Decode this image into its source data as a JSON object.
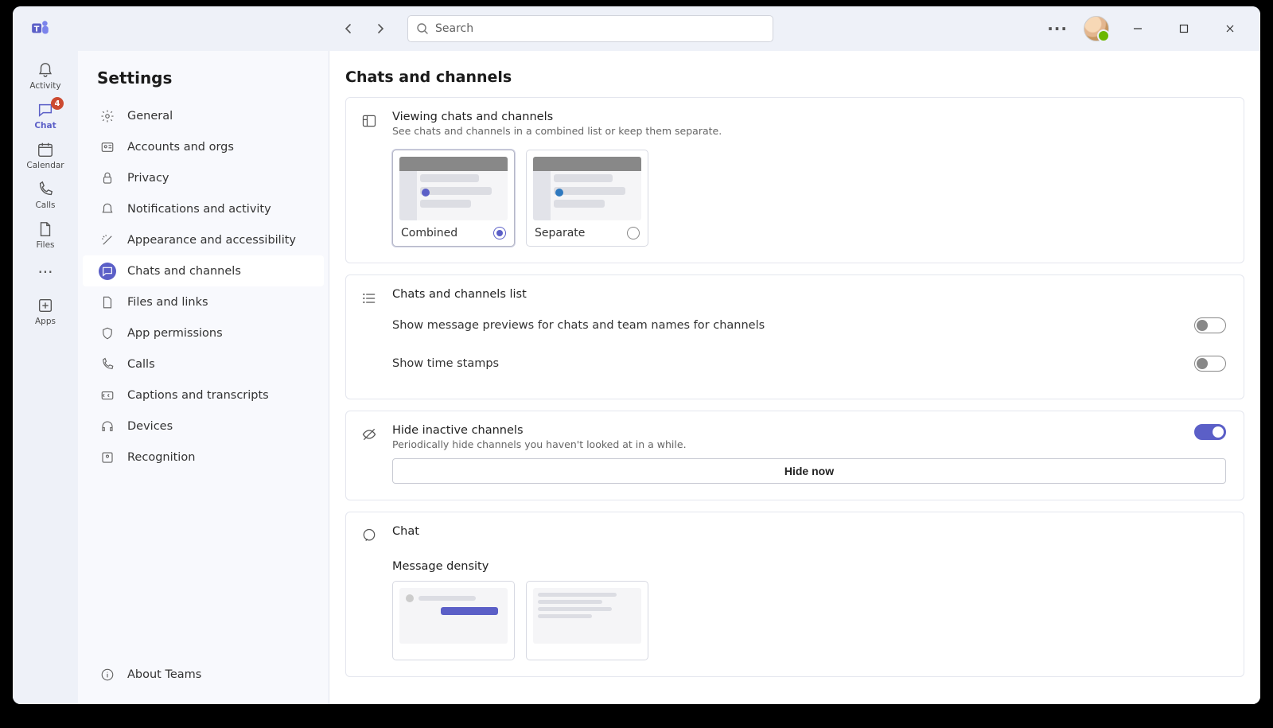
{
  "search": {
    "placeholder": "Search"
  },
  "rail": {
    "activity": {
      "label": "Activity"
    },
    "chat": {
      "label": "Chat",
      "badge": "4"
    },
    "calendar": {
      "label": "Calendar"
    },
    "calls": {
      "label": "Calls"
    },
    "files": {
      "label": "Files"
    },
    "apps": {
      "label": "Apps"
    }
  },
  "nav": {
    "title": "Settings",
    "items": {
      "general": "General",
      "accounts": "Accounts and orgs",
      "privacy": "Privacy",
      "notifications": "Notifications and activity",
      "appearance": "Appearance and accessibility",
      "chats": "Chats and channels",
      "files": "Files and links",
      "permissions": "App permissions",
      "calls": "Calls",
      "captions": "Captions and transcripts",
      "devices": "Devices",
      "recognition": "Recognition"
    },
    "about": "About Teams"
  },
  "page": {
    "title": "Chats and channels",
    "viewing": {
      "title": "Viewing chats and channels",
      "desc": "See chats and channels in a combined list or keep them separate.",
      "combined": "Combined",
      "separate": "Separate"
    },
    "list": {
      "title": "Chats and channels list",
      "previews": "Show message previews for chats and team names for channels",
      "timestamps": "Show time stamps"
    },
    "hide": {
      "title": "Hide inactive channels",
      "desc": "Periodically hide channels you haven't looked at in a while.",
      "button": "Hide now"
    },
    "chat": {
      "title": "Chat",
      "density": "Message density"
    }
  },
  "toggles": {
    "previews": false,
    "timestamps": false,
    "hide_inactive": true
  },
  "selected_view": "combined"
}
